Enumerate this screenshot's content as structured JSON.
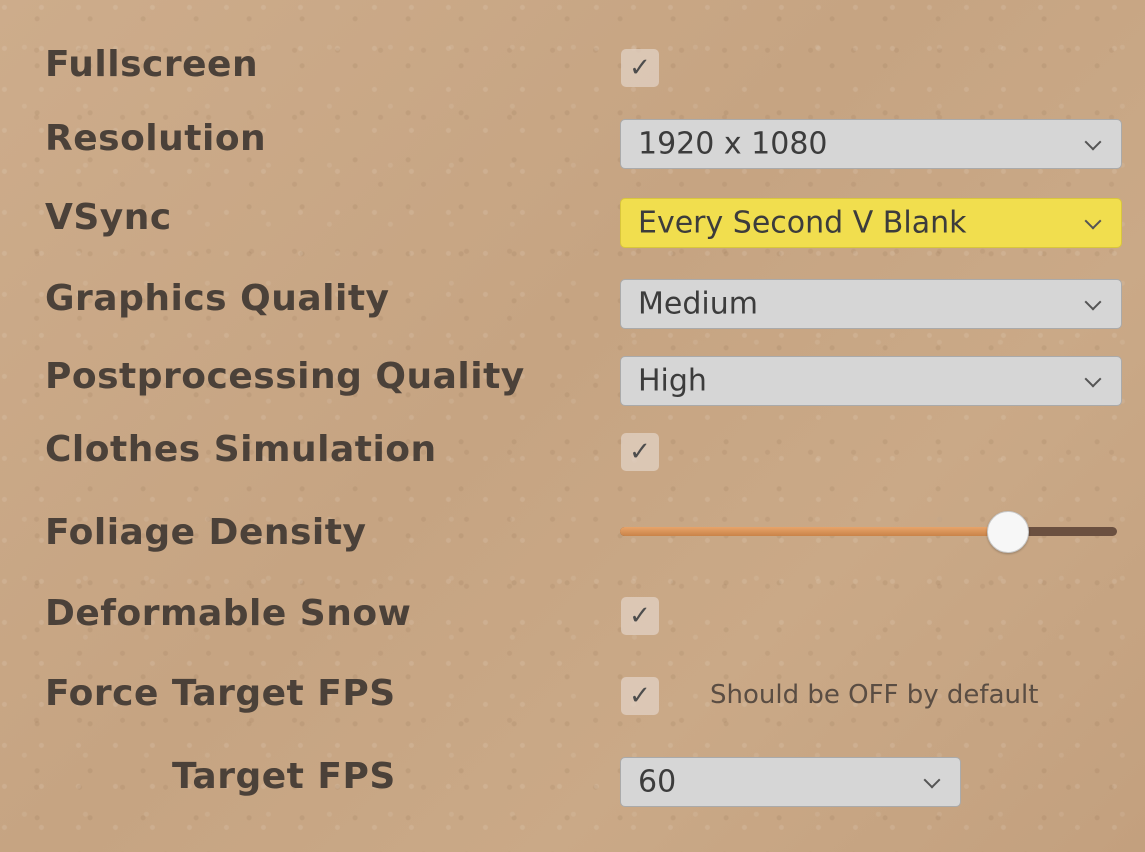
{
  "settings": {
    "fullscreen": {
      "label": "Fullscreen",
      "checked": true,
      "check_glyph": "✓"
    },
    "resolution": {
      "label": "Resolution",
      "value": "1920 x 1080"
    },
    "vsync": {
      "label": "VSync",
      "value": "Every Second V Blank",
      "highlight_color": "#f1de4e"
    },
    "graphics_quality": {
      "label": "Graphics Quality",
      "value": "Medium"
    },
    "postprocessing_quality": {
      "label": "Postprocessing Quality",
      "value": "High"
    },
    "clothes_simulation": {
      "label": "Clothes Simulation",
      "checked": true,
      "check_glyph": "✓"
    },
    "foliage_density": {
      "label": "Foliage Density",
      "value_fraction": 0.78
    },
    "deformable_snow": {
      "label": "Deformable Snow",
      "checked": true,
      "check_glyph": "✓"
    },
    "force_target_fps": {
      "label": "Force Target FPS",
      "checked": true,
      "check_glyph": "✓",
      "note": "Should be OFF by default"
    },
    "target_fps": {
      "label": "Target FPS",
      "value": "60"
    }
  },
  "icons": {
    "checkmark": "checkmark-icon",
    "dropdown_arrow": "chevron-down-icon"
  },
  "colors": {
    "background": "#c9a887",
    "label_text": "#4b4139",
    "slider_fill": "#d28f55",
    "slider_track": "#6b5040"
  }
}
